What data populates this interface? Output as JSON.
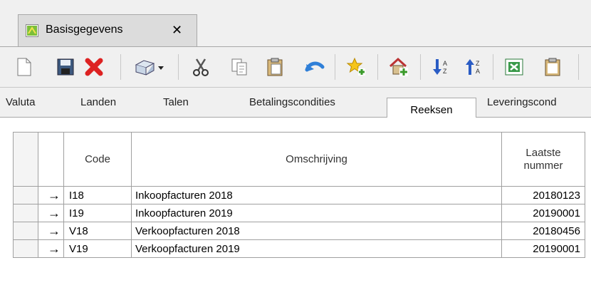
{
  "document_tab": {
    "title": "Basisgegevens",
    "close_symbol": "✕"
  },
  "toolbar": {
    "buttons": [
      {
        "name": "new-document-icon"
      },
      {
        "name": "save-icon"
      },
      {
        "name": "delete-icon"
      },
      {
        "name": "print-dropdown-icon"
      },
      {
        "name": "cut-icon"
      },
      {
        "name": "copy-icon"
      },
      {
        "name": "paste-icon"
      },
      {
        "name": "undo-icon"
      },
      {
        "name": "add-favorite-icon"
      },
      {
        "name": "add-home-icon"
      },
      {
        "name": "sort-ascending-icon"
      },
      {
        "name": "sort-descending-icon"
      },
      {
        "name": "excel-export-icon"
      },
      {
        "name": "clipboard-icon"
      }
    ]
  },
  "tabs": [
    {
      "label": "Valuta"
    },
    {
      "label": "Landen"
    },
    {
      "label": "Talen"
    },
    {
      "label": "Betalingscondities"
    },
    {
      "label": "Reeksen",
      "active": true
    },
    {
      "label": "Leveringscond"
    }
  ],
  "grid": {
    "columns": {
      "code": "Code",
      "description": "Omschrijving",
      "last_number_line1": "Laatste",
      "last_number_line2": "nummer"
    },
    "row_indicator": "→",
    "rows": [
      {
        "code": "I18",
        "description": "Inkoopfacturen 2018",
        "last_number": "20180123"
      },
      {
        "code": "I19",
        "description": "Inkoopfacturen 2019",
        "last_number": "20190001"
      },
      {
        "code": "V18",
        "description": "Verkoopfacturen 2018",
        "last_number": "20180456"
      },
      {
        "code": "V19",
        "description": "Verkoopfacturen 2019",
        "last_number": "20190001"
      }
    ]
  },
  "colors": {
    "chrome": "#f0f0f0",
    "tab_inactive": "#dcdcdc",
    "border": "#a0a0a0",
    "accent_green": "#5aa02c"
  }
}
